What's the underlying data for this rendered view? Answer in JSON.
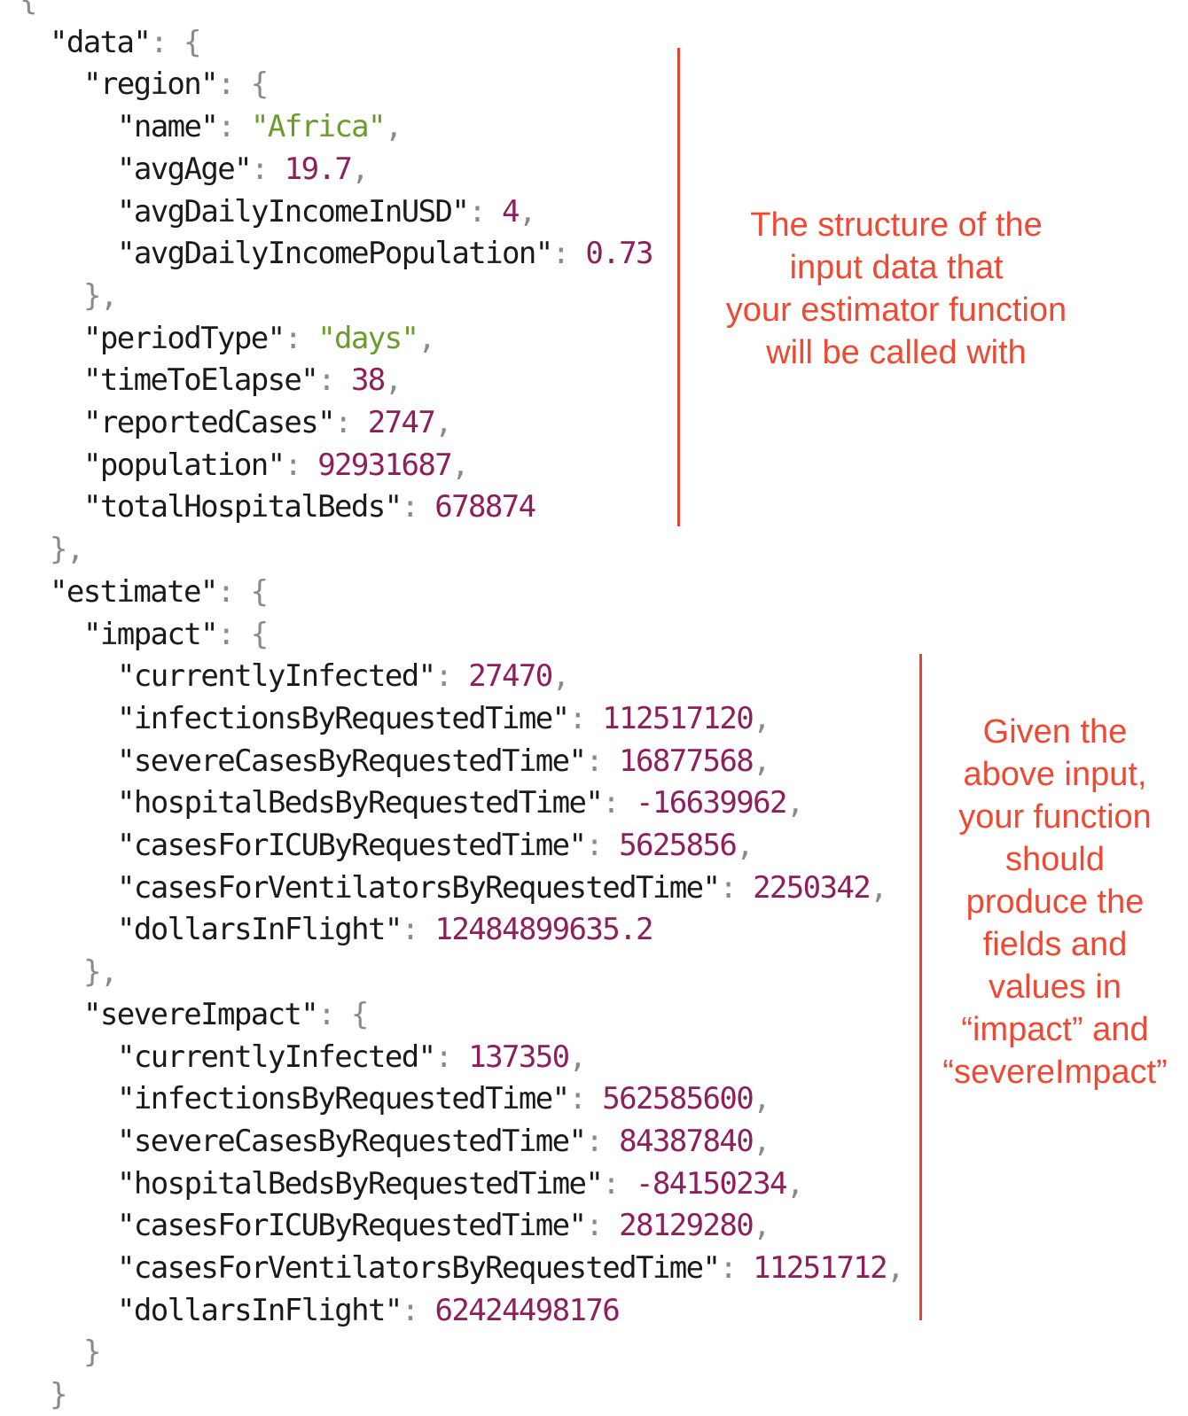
{
  "lines": [
    {
      "indent": 0,
      "parts": [
        {
          "t": "p",
          "v": "{"
        }
      ]
    },
    {
      "indent": 1,
      "parts": [
        {
          "t": "k",
          "v": "\"data\""
        },
        {
          "t": "p",
          "v": ": {"
        }
      ]
    },
    {
      "indent": 2,
      "parts": [
        {
          "t": "k",
          "v": "\"region\""
        },
        {
          "t": "p",
          "v": ": {"
        }
      ]
    },
    {
      "indent": 3,
      "parts": [
        {
          "t": "k",
          "v": "\"name\""
        },
        {
          "t": "p",
          "v": ": "
        },
        {
          "t": "s",
          "v": "\"Africa\""
        },
        {
          "t": "p",
          "v": ","
        }
      ]
    },
    {
      "indent": 3,
      "parts": [
        {
          "t": "k",
          "v": "\"avgAge\""
        },
        {
          "t": "p",
          "v": ": "
        },
        {
          "t": "n",
          "v": "19.7"
        },
        {
          "t": "p",
          "v": ","
        }
      ]
    },
    {
      "indent": 3,
      "parts": [
        {
          "t": "k",
          "v": "\"avgDailyIncomeInUSD\""
        },
        {
          "t": "p",
          "v": ": "
        },
        {
          "t": "n",
          "v": "4"
        },
        {
          "t": "p",
          "v": ","
        }
      ]
    },
    {
      "indent": 3,
      "parts": [
        {
          "t": "k",
          "v": "\"avgDailyIncomePopulation\""
        },
        {
          "t": "p",
          "v": ": "
        },
        {
          "t": "n",
          "v": "0.73"
        }
      ]
    },
    {
      "indent": 2,
      "parts": [
        {
          "t": "p",
          "v": "},"
        }
      ]
    },
    {
      "indent": 2,
      "parts": [
        {
          "t": "k",
          "v": "\"periodType\""
        },
        {
          "t": "p",
          "v": ": "
        },
        {
          "t": "s",
          "v": "\"days\""
        },
        {
          "t": "p",
          "v": ","
        }
      ]
    },
    {
      "indent": 2,
      "parts": [
        {
          "t": "k",
          "v": "\"timeToElapse\""
        },
        {
          "t": "p",
          "v": ": "
        },
        {
          "t": "n",
          "v": "38"
        },
        {
          "t": "p",
          "v": ","
        }
      ]
    },
    {
      "indent": 2,
      "parts": [
        {
          "t": "k",
          "v": "\"reportedCases\""
        },
        {
          "t": "p",
          "v": ": "
        },
        {
          "t": "n",
          "v": "2747"
        },
        {
          "t": "p",
          "v": ","
        }
      ]
    },
    {
      "indent": 2,
      "parts": [
        {
          "t": "k",
          "v": "\"population\""
        },
        {
          "t": "p",
          "v": ": "
        },
        {
          "t": "n",
          "v": "92931687"
        },
        {
          "t": "p",
          "v": ","
        }
      ]
    },
    {
      "indent": 2,
      "parts": [
        {
          "t": "k",
          "v": "\"totalHospitalBeds\""
        },
        {
          "t": "p",
          "v": ": "
        },
        {
          "t": "n",
          "v": "678874"
        }
      ]
    },
    {
      "indent": 1,
      "parts": [
        {
          "t": "p",
          "v": "},"
        }
      ]
    },
    {
      "indent": 1,
      "parts": [
        {
          "t": "k",
          "v": "\"estimate\""
        },
        {
          "t": "p",
          "v": ": {"
        }
      ]
    },
    {
      "indent": 2,
      "parts": [
        {
          "t": "k",
          "v": "\"impact\""
        },
        {
          "t": "p",
          "v": ": {"
        }
      ]
    },
    {
      "indent": 3,
      "parts": [
        {
          "t": "k",
          "v": "\"currentlyInfected\""
        },
        {
          "t": "p",
          "v": ": "
        },
        {
          "t": "n",
          "v": "27470"
        },
        {
          "t": "p",
          "v": ","
        }
      ]
    },
    {
      "indent": 3,
      "parts": [
        {
          "t": "k",
          "v": "\"infectionsByRequestedTime\""
        },
        {
          "t": "p",
          "v": ": "
        },
        {
          "t": "n",
          "v": "112517120"
        },
        {
          "t": "p",
          "v": ","
        }
      ]
    },
    {
      "indent": 3,
      "parts": [
        {
          "t": "k",
          "v": "\"severeCasesByRequestedTime\""
        },
        {
          "t": "p",
          "v": ": "
        },
        {
          "t": "n",
          "v": "16877568"
        },
        {
          "t": "p",
          "v": ","
        }
      ]
    },
    {
      "indent": 3,
      "parts": [
        {
          "t": "k",
          "v": "\"hospitalBedsByRequestedTime\""
        },
        {
          "t": "p",
          "v": ": "
        },
        {
          "t": "n",
          "v": "-16639962"
        },
        {
          "t": "p",
          "v": ","
        }
      ]
    },
    {
      "indent": 3,
      "parts": [
        {
          "t": "k",
          "v": "\"casesForICUByRequestedTime\""
        },
        {
          "t": "p",
          "v": ": "
        },
        {
          "t": "n",
          "v": "5625856"
        },
        {
          "t": "p",
          "v": ","
        }
      ]
    },
    {
      "indent": 3,
      "parts": [
        {
          "t": "k",
          "v": "\"casesForVentilatorsByRequestedTime\""
        },
        {
          "t": "p",
          "v": ": "
        },
        {
          "t": "n",
          "v": "2250342"
        },
        {
          "t": "p",
          "v": ","
        }
      ]
    },
    {
      "indent": 3,
      "parts": [
        {
          "t": "k",
          "v": "\"dollarsInFlight\""
        },
        {
          "t": "p",
          "v": ": "
        },
        {
          "t": "n",
          "v": "12484899635.2"
        }
      ]
    },
    {
      "indent": 2,
      "parts": [
        {
          "t": "p",
          "v": "},"
        }
      ]
    },
    {
      "indent": 2,
      "parts": [
        {
          "t": "k",
          "v": "\"severeImpact\""
        },
        {
          "t": "p",
          "v": ": {"
        }
      ]
    },
    {
      "indent": 3,
      "parts": [
        {
          "t": "k",
          "v": "\"currentlyInfected\""
        },
        {
          "t": "p",
          "v": ": "
        },
        {
          "t": "n",
          "v": "137350"
        },
        {
          "t": "p",
          "v": ","
        }
      ]
    },
    {
      "indent": 3,
      "parts": [
        {
          "t": "k",
          "v": "\"infectionsByRequestedTime\""
        },
        {
          "t": "p",
          "v": ": "
        },
        {
          "t": "n",
          "v": "562585600"
        },
        {
          "t": "p",
          "v": ","
        }
      ]
    },
    {
      "indent": 3,
      "parts": [
        {
          "t": "k",
          "v": "\"severeCasesByRequestedTime\""
        },
        {
          "t": "p",
          "v": ": "
        },
        {
          "t": "n",
          "v": "84387840"
        },
        {
          "t": "p",
          "v": ","
        }
      ]
    },
    {
      "indent": 3,
      "parts": [
        {
          "t": "k",
          "v": "\"hospitalBedsByRequestedTime\""
        },
        {
          "t": "p",
          "v": ": "
        },
        {
          "t": "n",
          "v": "-84150234"
        },
        {
          "t": "p",
          "v": ","
        }
      ]
    },
    {
      "indent": 3,
      "parts": [
        {
          "t": "k",
          "v": "\"casesForICUByRequestedTime\""
        },
        {
          "t": "p",
          "v": ": "
        },
        {
          "t": "n",
          "v": "28129280"
        },
        {
          "t": "p",
          "v": ","
        }
      ]
    },
    {
      "indent": 3,
      "parts": [
        {
          "t": "k",
          "v": "\"casesForVentilatorsByRequestedTime\""
        },
        {
          "t": "p",
          "v": ": "
        },
        {
          "t": "n",
          "v": "11251712"
        },
        {
          "t": "p",
          "v": ","
        }
      ]
    },
    {
      "indent": 3,
      "parts": [
        {
          "t": "k",
          "v": "\"dollarsInFlight\""
        },
        {
          "t": "p",
          "v": ": "
        },
        {
          "t": "n",
          "v": "62424498176"
        }
      ]
    },
    {
      "indent": 2,
      "parts": [
        {
          "t": "p",
          "v": "}"
        }
      ]
    },
    {
      "indent": 1,
      "parts": [
        {
          "t": "p",
          "v": "}"
        }
      ]
    }
  ],
  "annotations": {
    "input_note": [
      "The structure of the",
      "input data that",
      "your estimator function",
      "will be called with"
    ],
    "output_note": [
      "Given the",
      "above input,",
      "your function",
      "should",
      "produce the",
      "fields and",
      "values in",
      "“impact” and",
      "“severeImpact”"
    ]
  },
  "colors": {
    "key": "#1a1a1a",
    "punctuation": "#8a8a8a",
    "string": "#6b9b2c",
    "number": "#8e1f5c",
    "annotation": "#ee4a33"
  }
}
